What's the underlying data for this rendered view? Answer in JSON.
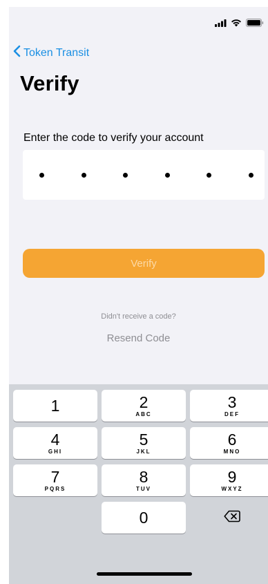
{
  "nav": {
    "back_label": "Token Transit"
  },
  "page": {
    "title": "Verify",
    "prompt": "Enter the code to verify your account",
    "code_length": 6
  },
  "actions": {
    "verify_label": "Verify",
    "no_code_text": "Didn't receive a code?",
    "resend_label": "Resend Code"
  },
  "keypad": {
    "keys": [
      {
        "digit": "1",
        "letters": ""
      },
      {
        "digit": "2",
        "letters": "ABC"
      },
      {
        "digit": "3",
        "letters": "DEF"
      },
      {
        "digit": "4",
        "letters": "GHI"
      },
      {
        "digit": "5",
        "letters": "JKL"
      },
      {
        "digit": "6",
        "letters": "MNO"
      },
      {
        "digit": "7",
        "letters": "PQRS"
      },
      {
        "digit": "8",
        "letters": "TUV"
      },
      {
        "digit": "9",
        "letters": "WXYZ"
      },
      {
        "digit": "0",
        "letters": ""
      }
    ]
  },
  "colors": {
    "accent": "#1a8fe3",
    "verify_button": "#f5a533",
    "background": "#f2f2f7",
    "keypad_background": "#d1d4d9"
  },
  "icons": {
    "back": "chevron-left-icon",
    "signal": "signal-icon",
    "wifi": "wifi-icon",
    "battery": "battery-icon",
    "backspace": "backspace-icon"
  }
}
